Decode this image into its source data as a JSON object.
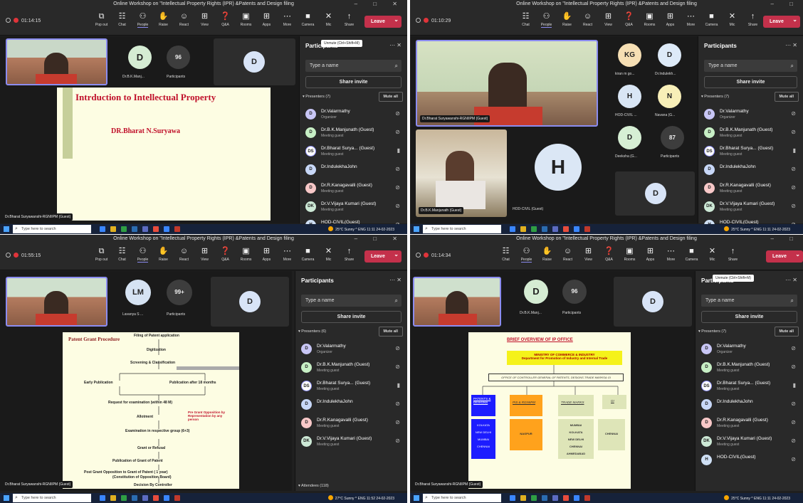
{
  "window_title": "Online Workshop on \"Intellectual Property Rights (IPR) &Patents and Design filing",
  "tools": [
    {
      "icon": "⧉",
      "label": "Pop out"
    },
    {
      "icon": "☷",
      "label": "Chat"
    },
    {
      "icon": "⚇",
      "label": "People"
    },
    {
      "icon": "✋",
      "label": "Raise"
    },
    {
      "icon": "☺",
      "label": "React"
    },
    {
      "icon": "⊞",
      "label": "View"
    },
    {
      "icon": "❓",
      "label": "Q&A"
    },
    {
      "icon": "▣",
      "label": "Rooms"
    },
    {
      "icon": "⊞",
      "label": "Apps"
    },
    {
      "icon": "⋯",
      "label": "More"
    },
    {
      "icon": "■",
      "label": "Camera"
    },
    {
      "icon": "✕",
      "label": "Mic"
    },
    {
      "icon": "↑",
      "label": "Share"
    }
  ],
  "leave_label": "Leave",
  "participants": {
    "title": "Participants",
    "search_placeholder": "Type a name",
    "share_invite": "Share invite",
    "mute_all": "Mute all",
    "organizer": "Organizer",
    "meeting_guest": "Meeting guest",
    "list": [
      {
        "initials": "D",
        "name": "Dr.Valarmathy",
        "sub": "Organizer",
        "color": "#c8c6f5"
      },
      {
        "initials": "D",
        "name": "Dr.B.K.Manjunath (Guest)",
        "sub": "Meeting guest",
        "color": "#c7efc5"
      },
      {
        "initials": "DS",
        "name": "Dr.Bharat Surya...  (Guest)",
        "sub": "Meeting guest",
        "color": "#ffffff"
      },
      {
        "initials": "D",
        "name": "Dr.IndulekhaJohn",
        "sub": "",
        "color": "#c8d8f8"
      },
      {
        "initials": "D",
        "name": "Dr.R.Kanagavalli (Guest)",
        "sub": "Meeting guest",
        "color": "#f8c8c8"
      },
      {
        "initials": "DK",
        "name": "Dr.V.Vijaya Kumari (Guest)",
        "sub": "Meeting guest",
        "color": "#cde9d6"
      },
      {
        "initials": "H",
        "name": "HOD-CIVIL(Guest)",
        "sub": "",
        "color": "#cfe0f5"
      }
    ]
  },
  "q1": {
    "timer": "01:14:15",
    "presenters": "Presenters (7)",
    "tooltip": "Unmute (Ctrl+Shift+M)",
    "tile_initial": "D",
    "tile_name": "Dr.B.K.Manj...",
    "count": "96",
    "count_label": "Participants",
    "right_initial": "D",
    "slide_title": "Intrduction to Intellectual Property",
    "slide_author": "DR.Bharat N.Suryawa",
    "caption": "Dr.Bharat Suryawanshi-RGNIIPM (Guest)"
  },
  "q2": {
    "timer": "01:10:29",
    "presenters": "Presenters (7)",
    "tiles": [
      {
        "initials": "KG",
        "name": "kiran m go...",
        "color": "#f6dfb4"
      },
      {
        "initials": "D",
        "name": "Dr.Indulekh...",
        "color": "#ddeaf8"
      },
      {
        "initials": "H",
        "name": "HOD-CIVIL ...",
        "color": "#d9e6f5"
      },
      {
        "initials": "N",
        "name": "Navana (G...",
        "color": "#f8efb8"
      },
      {
        "initials": "D",
        "name": "Deeksha (G...",
        "color": "#d6efd4"
      }
    ],
    "count": "87",
    "count_label": "Participants",
    "big_initial": "H",
    "big_name": "HOD-CIVIL (Guest)",
    "small_initial": "D",
    "cap_main": "Dr.Bharat Suryawanshi-RGNIIPM (Guest)",
    "cap_small": "Dr.B.K.Manjunath (Guest)"
  },
  "q3": {
    "timer": "01:55:15",
    "presenters": "Presenters (6)",
    "attendees": "Attendees (118)",
    "tile_initial": "LM",
    "tile_name": "Lavanya S ...",
    "count": "99+",
    "count_label": "Participants",
    "right_initial": "D",
    "slide": {
      "title": "Patent Grant Procedure",
      "steps": [
        "Filing of Patent application",
        "Digitization",
        "Screening & Classification",
        "Early Publication",
        "Publication after 18 months",
        "Request for examination (within 48 M)",
        "Allotment",
        "Pre Grant Opposition by Representation by any person",
        "Examination in respective group (6+3)",
        "Grant or Refusal",
        "Publication of Grant of Patent",
        "Post Grant Opposition to Grant of Patent  ( 1 year)",
        "(Constitution of Opposition Board)",
        "Decision By Controller"
      ]
    },
    "caption": "Dr.Bharat Suryawanshi-RGNIIPM (Guest)"
  },
  "q4": {
    "timer": "01:14:34",
    "presenters": "Presenters (7)",
    "tooltip": "Unmute (Ctrl+Shift+M)",
    "tile_initial": "D",
    "tile_name": "Dr.B.K.Manj...",
    "count": "96",
    "count_label": "Participants",
    "right_initial": "D",
    "slide": {
      "title": "BRIEF OVERVIEW OF  IP  OFFICE",
      "ministry": "MINISTRY OF COMMERCE & INDUSTRY",
      "dept": "Department for Promotion of Industry and Internal Trade",
      "office": "OFFICE OF CONTROLLER GENERAL OF PATENTS, DESIGNS TRADE MARKS& GI",
      "boxes": [
        "PATENTS & DESIGNS",
        "PIS & RGNIIPM",
        "TRADE MARKS",
        "GI"
      ],
      "patents": "KOLKATA\nNEW DELHI\nMUMBAI\nCHENNAI",
      "nagpur": "NAGPUR",
      "tm": "MUMBAI\nKOLKATA\nNEW DELHI\nCHENNAI\nAHMEDABAD",
      "gi": "CHENNAI"
    },
    "caption": "Dr.Bharat Suryawanshi-RGNIIPM (Guest)"
  },
  "taskbar": {
    "search": "Type here to search",
    "tray_q1": "25°C Sunny  ^  ENG  11:11  24-02-2023",
    "tray_q3": "27°C Sunny  ^  ENG  11:52  24-02-2023",
    "tray_q4": "25°C Sunny  ^  ENG  11:11  24-02-2023"
  }
}
